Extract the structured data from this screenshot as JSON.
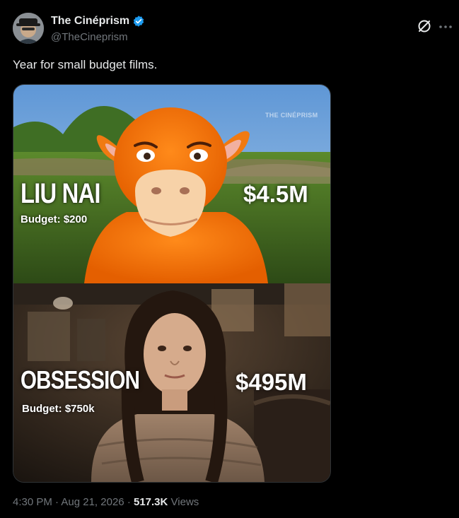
{
  "author": {
    "display_name": "The Cinéprism",
    "handle": "@TheCineprism",
    "verified": true,
    "avatar_icon": "avatar"
  },
  "tweet": {
    "text": "Year for small budget films."
  },
  "media": {
    "watermark": "THE CINÉPRISM",
    "films": [
      {
        "title": "LIU NAI",
        "budget": "Budget: $200",
        "gross": "$4.5M"
      },
      {
        "title": "OBSESSION",
        "budget": "Budget: $750k",
        "gross": "$495M"
      }
    ]
  },
  "meta": {
    "time": "4:30 PM",
    "separator": "·",
    "date": "Aug 21, 2026",
    "views_count": "517.3K",
    "views_label": "Views"
  },
  "colors": {
    "background": "#000000",
    "text": "#e7e9ea",
    "muted": "#71767b",
    "verified": "#1d9bf0",
    "border": "#2f3336"
  }
}
